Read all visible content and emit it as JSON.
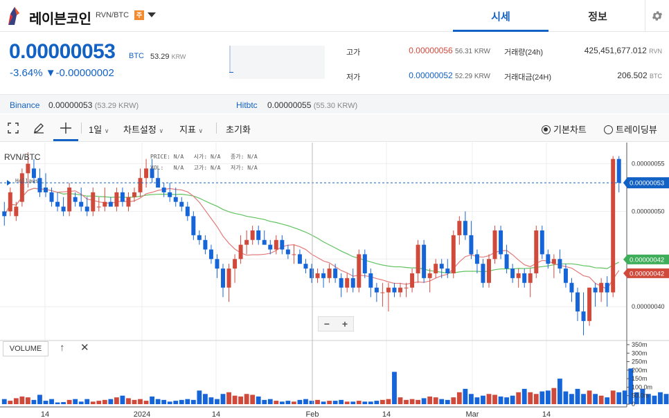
{
  "header": {
    "coin_name": "레이븐코인",
    "pair": "RVN/BTC",
    "warning_badge": "주",
    "tabs": [
      "시세",
      "정보"
    ]
  },
  "summary": {
    "price": "0.00000053",
    "price_unit": "BTC",
    "price_krw": "53.29",
    "price_krw_unit": "KRW",
    "change_pct": "-3.64%",
    "change_arrow": "▼",
    "change_abs": "-0.00000002",
    "high_label": "고가",
    "high_value": "0.00000056",
    "high_krw": "56.31 KRW",
    "low_label": "저가",
    "low_value": "0.00000052",
    "low_krw": "52.29 KRW",
    "volume_label": "거래량(24h)",
    "volume_value": "425,451,677.012",
    "volume_unit": "RVN",
    "amount_label": "거래대금(24H)",
    "amount_value": "206.502",
    "amount_unit": "BTC"
  },
  "exchanges": [
    {
      "name": "Binance",
      "price": "0.00000053",
      "krw": "(53.29 KRW)"
    },
    {
      "name": "Hitbtc",
      "price": "0.00000055",
      "krw": "(55.30 KRW)"
    }
  ],
  "toolbar": {
    "interval": "1일",
    "chart_settings": "차트설정",
    "indicators": "지표",
    "reset": "초기화",
    "basic_chart": "기본차트",
    "tradingview": "트레이딩뷰"
  },
  "overlay": {
    "symbol": "RVN/BTC",
    "label_marker": "Hollaws",
    "price_lbl": "PRICE:",
    "price_val": "N/A",
    "open_lbl": "시가:",
    "open_val": "N/A",
    "close_lbl": "종가:",
    "close_val": "N/A",
    "vol_lbl": "VOL:",
    "vol_val": "N/A",
    "high_lbl": "고가:",
    "high_val": "N/A",
    "low_lbl": "저가:",
    "low_val": "N/A"
  },
  "volume_panel": {
    "title": "VOLUME",
    "up_icon": "↑",
    "close_icon": "✕"
  },
  "colors": {
    "accent": "#1261c4",
    "up": "#d04a3c",
    "down": "#1565d8",
    "ma_short": "#e47a7a",
    "ma_long": "#5ec25e"
  },
  "chart_data": [
    {
      "type": "candlestick",
      "title": "RVN/BTC",
      "x_ticks": [
        "14",
        "2024",
        "14",
        "Feb",
        "14",
        "Mar",
        "14"
      ],
      "y_ticks": [
        "0.00000055",
        "0.00000050",
        "0.00000045",
        "0.00000040"
      ],
      "ylim": [
        3.66e-07,
        5.722e-07
      ],
      "current_price_label": "0.00000053",
      "ma_labels": [
        "0.00000042",
        "0.00000042"
      ],
      "candles": [
        {
          "o": 5e-07,
          "h": 5.1e-07,
          "l": 4.85e-07,
          "c": 4.95e-07
        },
        {
          "o": 5e-07,
          "h": 5.25e-07,
          "l": 4.95e-07,
          "c": 5.2e-07
        },
        {
          "o": 4.95e-07,
          "h": 5.1e-07,
          "l": 4.9e-07,
          "c": 5.05e-07
        },
        {
          "o": 5.1e-07,
          "h": 5.45e-07,
          "l": 5.05e-07,
          "c": 5.4e-07
        },
        {
          "o": 5.4e-07,
          "h": 5.62e-07,
          "l": 5.25e-07,
          "c": 5.5e-07
        },
        {
          "o": 5.45e-07,
          "h": 5.55e-07,
          "l": 5.3e-07,
          "c": 5.35e-07
        },
        {
          "o": 5.35e-07,
          "h": 5.45e-07,
          "l": 5.15e-07,
          "c": 5.2e-07
        },
        {
          "o": 5.25e-07,
          "h": 5.4e-07,
          "l": 5.15e-07,
          "c": 5.2e-07
        },
        {
          "o": 5.2e-07,
          "h": 5.25e-07,
          "l": 5.05e-07,
          "c": 5.1e-07
        },
        {
          "o": 5.1e-07,
          "h": 5.2e-07,
          "l": 5e-07,
          "c": 5.05e-07
        },
        {
          "o": 5.05e-07,
          "h": 5.15e-07,
          "l": 4.95e-07,
          "c": 5e-07
        },
        {
          "o": 5e-07,
          "h": 5.3e-07,
          "l": 4.95e-07,
          "c": 5.25e-07
        },
        {
          "o": 5.15e-07,
          "h": 5.2e-07,
          "l": 5.05e-07,
          "c": 5.1e-07
        },
        {
          "o": 5.1e-07,
          "h": 5.25e-07,
          "l": 5e-07,
          "c": 5.05e-07
        },
        {
          "o": 5.05e-07,
          "h": 5.15e-07,
          "l": 4.95e-07,
          "c": 5e-07
        },
        {
          "o": 5e-07,
          "h": 5.25e-07,
          "l": 4.95e-07,
          "c": 5.2e-07
        },
        {
          "o": 5.05e-07,
          "h": 5.15e-07,
          "l": 5e-07,
          "c": 5.05e-07
        },
        {
          "o": 5.05e-07,
          "h": 5.25e-07,
          "l": 5e-07,
          "c": 5.1e-07
        },
        {
          "o": 5.1e-07,
          "h": 5.15e-07,
          "l": 5.05e-07,
          "c": 5.05e-07
        },
        {
          "o": 5.05e-07,
          "h": 5.25e-07,
          "l": 5e-07,
          "c": 5.2e-07
        },
        {
          "o": 5.2e-07,
          "h": 5.25e-07,
          "l": 5.05e-07,
          "c": 5.1e-07
        },
        {
          "o": 5.05e-07,
          "h": 5.2e-07,
          "l": 5e-07,
          "c": 5.15e-07
        },
        {
          "o": 5.15e-07,
          "h": 5.25e-07,
          "l": 5.1e-07,
          "c": 5.2e-07
        },
        {
          "o": 5.2e-07,
          "h": 5.45e-07,
          "l": 5.15e-07,
          "c": 5.35e-07
        },
        {
          "o": 5.35e-07,
          "h": 5.55e-07,
          "l": 5.25e-07,
          "c": 5.45e-07
        },
        {
          "o": 5.45e-07,
          "h": 5.55e-07,
          "l": 5.3e-07,
          "c": 5.35e-07
        },
        {
          "o": 5.35e-07,
          "h": 5.45e-07,
          "l": 5.25e-07,
          "c": 5.25e-07
        },
        {
          "o": 5.25e-07,
          "h": 5.3e-07,
          "l": 5.15e-07,
          "c": 5.2e-07
        },
        {
          "o": 5.2e-07,
          "h": 5.3e-07,
          "l": 5.1e-07,
          "c": 5.15e-07
        },
        {
          "o": 5.15e-07,
          "h": 5.25e-07,
          "l": 5.05e-07,
          "c": 5.1e-07
        },
        {
          "o": 5.1e-07,
          "h": 5.15e-07,
          "l": 5e-07,
          "c": 5.05e-07
        },
        {
          "o": 5.05e-07,
          "h": 5.1e-07,
          "l": 4.9e-07,
          "c": 4.95e-07
        },
        {
          "o": 4.95e-07,
          "h": 5e-07,
          "l": 4.7e-07,
          "c": 4.75e-07
        },
        {
          "o": 4.75e-07,
          "h": 4.8e-07,
          "l": 4.65e-07,
          "c": 4.7e-07
        },
        {
          "o": 4.7e-07,
          "h": 4.75e-07,
          "l": 4.55e-07,
          "c": 4.6e-07
        },
        {
          "o": 4.6e-07,
          "h": 4.65e-07,
          "l": 4.45e-07,
          "c": 4.5e-07
        },
        {
          "o": 4.5e-07,
          "h": 4.55e-07,
          "l": 4.3e-07,
          "c": 4.4e-07
        },
        {
          "o": 4.4e-07,
          "h": 4.45e-07,
          "l": 4.1e-07,
          "c": 4.2e-07
        },
        {
          "o": 4.2e-07,
          "h": 4.45e-07,
          "l": 4.05e-07,
          "c": 4.4e-07
        },
        {
          "o": 4.4e-07,
          "h": 4.55e-07,
          "l": 4.25e-07,
          "c": 4.5e-07
        },
        {
          "o": 4.5e-07,
          "h": 4.75e-07,
          "l": 4.45e-07,
          "c": 4.65e-07
        },
        {
          "o": 4.65e-07,
          "h": 4.8e-07,
          "l": 4.55e-07,
          "c": 4.7e-07
        },
        {
          "o": 4.7e-07,
          "h": 4.85e-07,
          "l": 4.65e-07,
          "c": 4.8e-07
        },
        {
          "o": 4.8e-07,
          "h": 4.85e-07,
          "l": 4.65e-07,
          "c": 4.7e-07
        },
        {
          "o": 4.7e-07,
          "h": 4.8e-07,
          "l": 4.65e-07,
          "c": 4.65e-07
        },
        {
          "o": 4.65e-07,
          "h": 4.7e-07,
          "l": 4.55e-07,
          "c": 4.6e-07
        },
        {
          "o": 4.6e-07,
          "h": 4.75e-07,
          "l": 4.55e-07,
          "c": 4.7e-07
        },
        {
          "o": 4.7e-07,
          "h": 4.75e-07,
          "l": 4.55e-07,
          "c": 4.6e-07
        },
        {
          "o": 4.6e-07,
          "h": 4.65e-07,
          "l": 4.5e-07,
          "c": 4.55e-07
        },
        {
          "o": 4.55e-07,
          "h": 4.65e-07,
          "l": 4.45e-07,
          "c": 4.55e-07
        },
        {
          "o": 4.55e-07,
          "h": 4.6e-07,
          "l": 4.45e-07,
          "c": 4.45e-07
        },
        {
          "o": 4.45e-07,
          "h": 4.5e-07,
          "l": 4.35e-07,
          "c": 4.4e-07
        },
        {
          "o": 4.4e-07,
          "h": 4.45e-07,
          "l": 4.25e-07,
          "c": 4.3e-07
        },
        {
          "o": 4.3e-07,
          "h": 4.4e-07,
          "l": 4.25e-07,
          "c": 4.35e-07
        },
        {
          "o": 4.35e-07,
          "h": 4.4e-07,
          "l": 4.2e-07,
          "c": 4.3e-07
        },
        {
          "o": 4.3e-07,
          "h": 4.45e-07,
          "l": 4.25e-07,
          "c": 4.4e-07
        },
        {
          "o": 4.4e-07,
          "h": 4.45e-07,
          "l": 4.25e-07,
          "c": 4.3e-07
        },
        {
          "o": 4.3e-07,
          "h": 4.35e-07,
          "l": 4.1e-07,
          "c": 4.2e-07
        },
        {
          "o": 4.2e-07,
          "h": 4.35e-07,
          "l": 4.15e-07,
          "c": 4.3e-07
        },
        {
          "o": 4.3e-07,
          "h": 4.4e-07,
          "l": 4.15e-07,
          "c": 4.2e-07
        },
        {
          "o": 4.2e-07,
          "h": 4.6e-07,
          "l": 4.15e-07,
          "c": 4.55e-07
        },
        {
          "o": 4.55e-07,
          "h": 4.6e-07,
          "l": 4.3e-07,
          "c": 4.35e-07
        },
        {
          "o": 4.35e-07,
          "h": 4.4e-07,
          "l": 4.1e-07,
          "c": 4.2e-07
        },
        {
          "o": 4.2e-07,
          "h": 4.25e-07,
          "l": 4.05e-07,
          "c": 4.15e-07
        },
        {
          "o": 4.15e-07,
          "h": 4.25e-07,
          "l": 4e-07,
          "c": 4.15e-07
        },
        {
          "o": 4.15e-07,
          "h": 4.25e-07,
          "l": 3.95e-07,
          "c": 4.2e-07
        },
        {
          "o": 4.2e-07,
          "h": 4.25e-07,
          "l": 4.1e-07,
          "c": 4.15e-07
        },
        {
          "o": 4.15e-07,
          "h": 4.25e-07,
          "l": 4.1e-07,
          "c": 4.2e-07
        },
        {
          "o": 4.2e-07,
          "h": 4.25e-07,
          "l": 4.1e-07,
          "c": 4.2e-07
        },
        {
          "o": 4.2e-07,
          "h": 4.4e-07,
          "l": 4.15e-07,
          "c": 4.35e-07
        },
        {
          "o": 4.35e-07,
          "h": 4.7e-07,
          "l": 4.25e-07,
          "c": 4.65e-07
        },
        {
          "o": 4.65e-07,
          "h": 4.7e-07,
          "l": 4.25e-07,
          "c": 4.3e-07
        },
        {
          "o": 4.3e-07,
          "h": 4.4e-07,
          "l": 4.15e-07,
          "c": 4.35e-07
        },
        {
          "o": 4.35e-07,
          "h": 4.5e-07,
          "l": 4.3e-07,
          "c": 4.45e-07
        },
        {
          "o": 4.45e-07,
          "h": 4.5e-07,
          "l": 4.3e-07,
          "c": 4.4e-07
        },
        {
          "o": 4.4e-07,
          "h": 4.5e-07,
          "l": 4.3e-07,
          "c": 4.35e-07
        },
        {
          "o": 4.35e-07,
          "h": 4.8e-07,
          "l": 4.3e-07,
          "c": 4.75e-07
        },
        {
          "o": 4.75e-07,
          "h": 4.95e-07,
          "l": 4.65e-07,
          "c": 4.9e-07
        },
        {
          "o": 4.9e-07,
          "h": 5e-07,
          "l": 4.7e-07,
          "c": 4.75e-07
        },
        {
          "o": 4.75e-07,
          "h": 4.9e-07,
          "l": 4.5e-07,
          "c": 4.55e-07
        },
        {
          "o": 4.55e-07,
          "h": 4.6e-07,
          "l": 4.35e-07,
          "c": 4.45e-07
        },
        {
          "o": 4.45e-07,
          "h": 4.5e-07,
          "l": 4.2e-07,
          "c": 4.25e-07
        },
        {
          "o": 4.25e-07,
          "h": 4.55e-07,
          "l": 4.2e-07,
          "c": 4.5e-07
        },
        {
          "o": 4.5e-07,
          "h": 4.85e-07,
          "l": 4.45e-07,
          "c": 4.8e-07
        },
        {
          "o": 4.8e-07,
          "h": 4.85e-07,
          "l": 4.5e-07,
          "c": 4.55e-07
        },
        {
          "o": 4.55e-07,
          "h": 4.65e-07,
          "l": 4.35e-07,
          "c": 4.4e-07
        },
        {
          "o": 4.4e-07,
          "h": 4.45e-07,
          "l": 4.25e-07,
          "c": 4.3e-07
        },
        {
          "o": 4.3e-07,
          "h": 4.4e-07,
          "l": 4.2e-07,
          "c": 4.35e-07
        },
        {
          "o": 4.35e-07,
          "h": 4.4e-07,
          "l": 4.2e-07,
          "c": 4.25e-07
        },
        {
          "o": 4.25e-07,
          "h": 4.4e-07,
          "l": 4.1e-07,
          "c": 4.35e-07
        },
        {
          "o": 4.35e-07,
          "h": 4.85e-07,
          "l": 4.3e-07,
          "c": 4.8e-07
        },
        {
          "o": 4.8e-07,
          "h": 4.85e-07,
          "l": 4.5e-07,
          "c": 4.55e-07
        },
        {
          "o": 4.55e-07,
          "h": 4.6e-07,
          "l": 4.4e-07,
          "c": 4.45e-07
        },
        {
          "o": 4.45e-07,
          "h": 4.55e-07,
          "l": 4.3e-07,
          "c": 4.5e-07
        },
        {
          "o": 4.5e-07,
          "h": 4.6e-07,
          "l": 4.35e-07,
          "c": 4.4e-07
        },
        {
          "o": 4.4e-07,
          "h": 4.45e-07,
          "l": 4.2e-07,
          "c": 4.25e-07
        },
        {
          "o": 4.25e-07,
          "h": 4.3e-07,
          "l": 4.05e-07,
          "c": 4.15e-07
        },
        {
          "o": 4.15e-07,
          "h": 4.2e-07,
          "l": 3.85e-07,
          "c": 3.95e-07
        },
        {
          "o": 3.95e-07,
          "h": 4.15e-07,
          "l": 3.7e-07,
          "c": 3.85e-07
        },
        {
          "o": 3.85e-07,
          "h": 4.2e-07,
          "l": 3.8e-07,
          "c": 4.2e-07
        },
        {
          "o": 4.2e-07,
          "h": 4.25e-07,
          "l": 4e-07,
          "c": 4.15e-07
        },
        {
          "o": 4.15e-07,
          "h": 4.3e-07,
          "l": 4.05e-07,
          "c": 4.25e-07
        },
        {
          "o": 4.25e-07,
          "h": 4.32e-07,
          "l": 4e-07,
          "c": 4.15e-07
        },
        {
          "o": 4.15e-07,
          "h": 5.58e-07,
          "l": 4.1e-07,
          "c": 5.55e-07
        },
        {
          "o": 5.55e-07,
          "h": 5.58e-07,
          "l": 5.2e-07,
          "c": 5.3e-07
        }
      ]
    },
    {
      "type": "bar",
      "title": "VOLUME",
      "y_ticks": [
        "350m",
        "300m",
        "250m",
        "200m",
        "150m",
        "100.0m",
        "50.0m",
        "0"
      ],
      "ylim": [
        0,
        350
      ],
      "volumes": [
        30,
        20,
        35,
        45,
        40,
        25,
        55,
        20,
        30,
        10,
        12,
        25,
        30,
        15,
        30,
        15,
        20,
        25,
        30,
        40,
        50,
        35,
        25,
        30,
        20,
        45,
        30,
        25,
        15,
        20,
        25,
        30,
        25,
        80,
        60,
        40,
        30,
        60,
        70,
        50,
        45,
        60,
        55,
        45,
        25,
        30,
        20,
        15,
        20,
        15,
        25,
        30,
        20,
        25,
        15,
        20,
        20,
        25,
        15,
        15,
        20,
        15,
        15,
        20,
        25,
        30,
        190,
        40,
        25,
        30,
        25,
        35,
        45,
        40,
        30,
        25,
        40,
        70,
        90,
        60,
        40,
        50,
        60,
        55,
        45,
        40,
        50,
        70,
        90,
        70,
        60,
        75,
        80,
        95,
        150,
        75,
        60,
        90,
        60,
        80,
        60,
        50,
        40,
        80,
        70,
        80,
        210,
        70,
        90,
        60,
        50,
        70,
        60,
        70,
        80,
        50,
        60,
        40,
        30,
        70,
        340,
        80
      ]
    }
  ]
}
